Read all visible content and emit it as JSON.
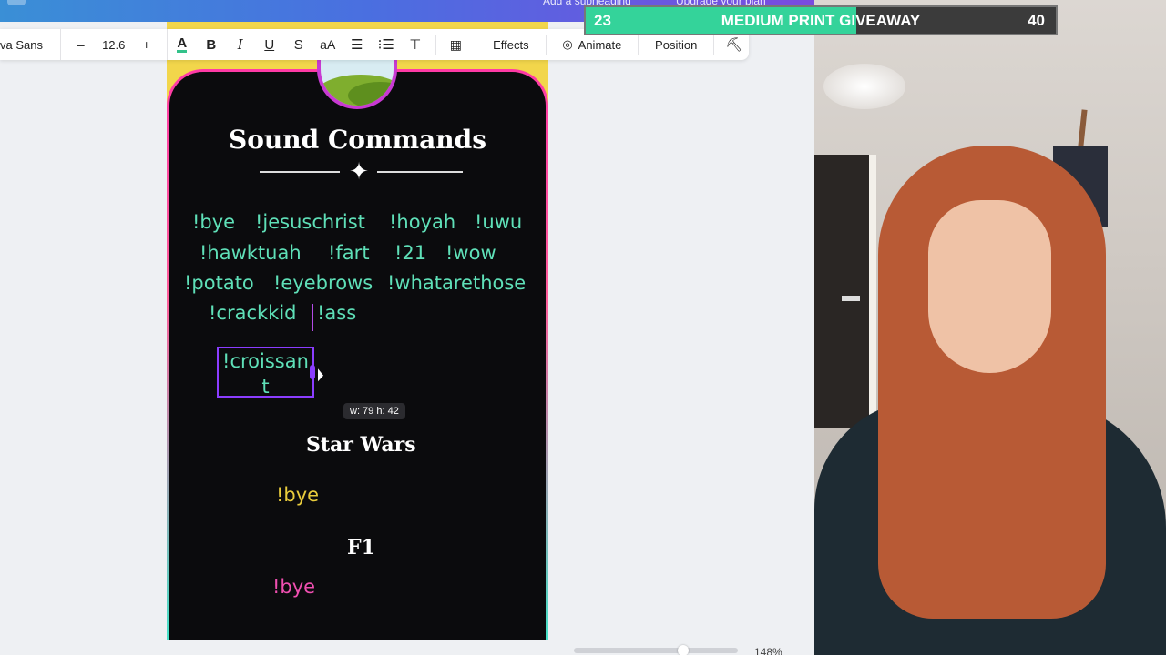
{
  "topbar": {
    "subheading_text": "Add a subheading",
    "upgrade_text": "Upgrade your plan"
  },
  "toolbar": {
    "font_name": "va Sans",
    "minus": "–",
    "font_size": "12.6",
    "plus": "+",
    "color_glyph": "A",
    "bold_glyph": "B",
    "italic_glyph": "I",
    "underline_glyph": "U",
    "strike_glyph": "S",
    "case_glyph": "aA",
    "effects_label": "Effects",
    "animate_label": "Animate",
    "position_label": "Position"
  },
  "design": {
    "title": "Sound Commands",
    "commands_row1": [
      "!bye",
      "!jesuschrist",
      "!hoyah",
      "!uwu"
    ],
    "commands_row2": [
      "!hawktuah",
      "!fart",
      "!21",
      "!wow"
    ],
    "commands_row3": [
      "!potato",
      "!eyebrows",
      "!whatarethose"
    ],
    "commands_row4": [
      "!crackkid",
      "!ass"
    ],
    "editing_line1": "!croissan",
    "editing_line2": "t",
    "size_tooltip": "w: 79 h: 42",
    "section_starwars": "Star Wars",
    "starwars_cmd": "!bye",
    "section_f1": "F1",
    "f1_cmd": "!bye"
  },
  "zoom": {
    "value": "148%"
  },
  "giveaway": {
    "current": "23",
    "label": "MEDIUM PRINT GIVEAWAY",
    "goal": "40",
    "progress_fraction": 0.575,
    "fill_color": "#34d39a"
  },
  "colors": {
    "command_teal": "#5fe0b8",
    "starwars_yellow": "#e9cc3c",
    "f1_pink": "#f04fb0",
    "selection_purple": "#8b3dff"
  }
}
